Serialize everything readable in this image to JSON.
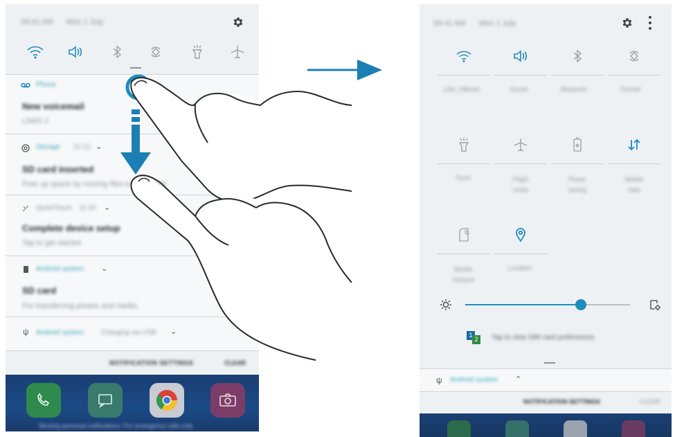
{
  "left_phone": {
    "status": {
      "time": "09:41 AM",
      "date": "Mon 1 July"
    },
    "quick_icons": [
      "wifi-icon",
      "sound-icon",
      "bluetooth-icon",
      "auto-rotate-icon",
      "torch-icon",
      "flight-mode-icon"
    ],
    "notifications": [
      {
        "app": "Phone",
        "title": "New voicemail",
        "body": "LIMIS 2"
      },
      {
        "app": "Storage",
        "time": "11:12",
        "title": "SD card inserted",
        "body": "Free up space by moving files to your card"
      },
      {
        "app": "QuickTouch",
        "time": "11:20",
        "title": "Complete device setup",
        "body": "Tap to get started"
      },
      {
        "app": "Android system",
        "title": "SD card",
        "body": "For transferring photos and media"
      },
      {
        "app": "Android system",
        "detail": "Charging via USB"
      }
    ],
    "actions": {
      "settings": "NOTIFICATION SETTINGS",
      "clear": "CLEAR"
    },
    "dock_hint": "Missing personal notifications. For emergency calls only"
  },
  "right_phone": {
    "status": {
      "time": "09:41 AM",
      "date": "Mon 1 July"
    },
    "tiles": [
      {
        "icon": "wifi-icon",
        "label": "LAN_Offered",
        "active": true
      },
      {
        "icon": "sound-icon",
        "label": "Sound",
        "active": true
      },
      {
        "icon": "bluetooth-icon",
        "label": "Bluetooth",
        "active": false
      },
      {
        "icon": "auto-rotate-icon",
        "label": "Portrait",
        "active": false
      },
      {
        "icon": "torch-icon",
        "label": "Torch",
        "active": false
      },
      {
        "icon": "flight-mode-icon",
        "label": "Flight mode",
        "active": false
      },
      {
        "icon": "power-saving-icon",
        "label": "Power saving",
        "active": false
      },
      {
        "icon": "mobile-data-icon",
        "label": "Mobile data",
        "active": true
      },
      {
        "icon": "mobile-hotspot-icon",
        "label": "Mobile Hotspot",
        "active": false
      },
      {
        "icon": "location-icon",
        "label": "Location",
        "active": true
      }
    ],
    "brightness": 0.7,
    "sim_hint": "Tap to view SIM card preferences",
    "usb_app": "Android system",
    "actions": {
      "settings": "NOTIFICATION SETTINGS",
      "clear": "CLEAR"
    }
  },
  "colors": {
    "accent": "#1c8dbd",
    "hand_stroke": "#2a2a2a",
    "arrow": "#1b7fb5"
  }
}
